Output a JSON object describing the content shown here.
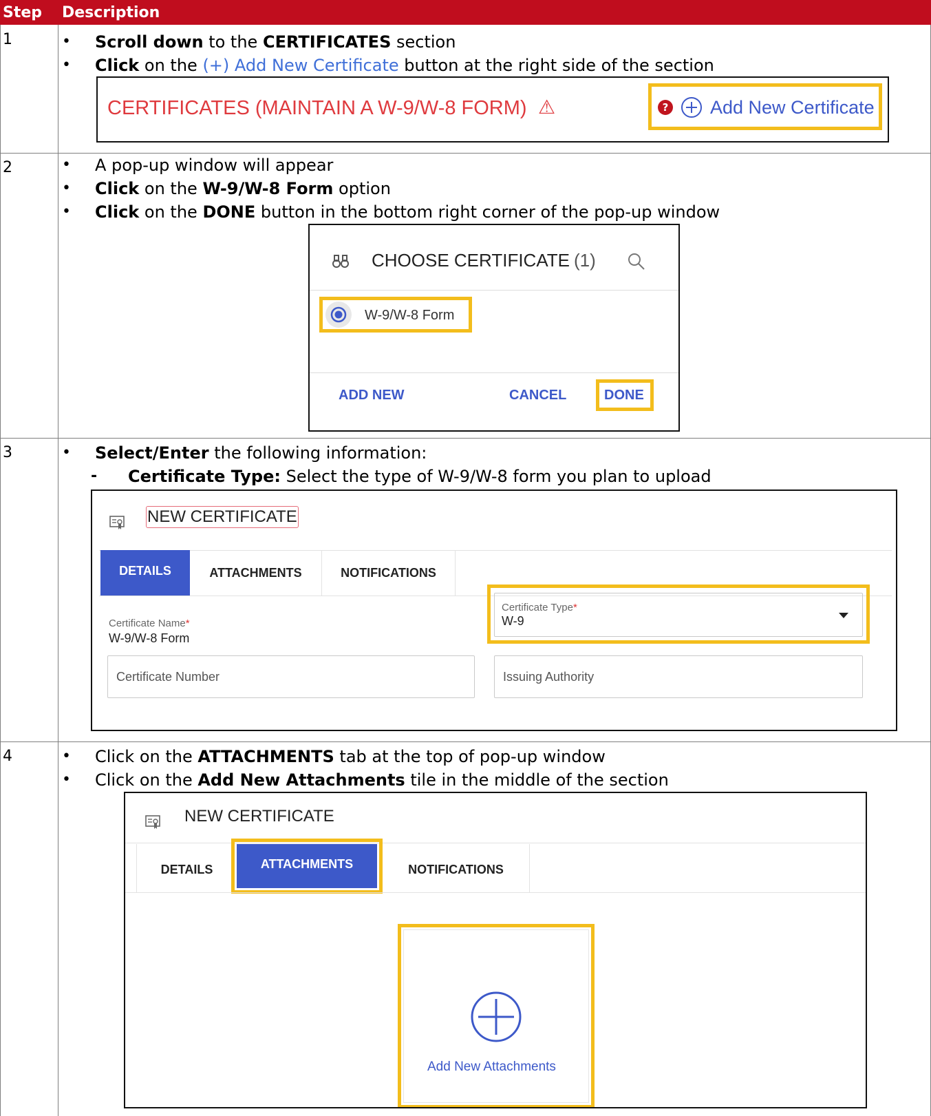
{
  "header": {
    "step": "Step",
    "description": "Description"
  },
  "steps": [
    {
      "number": "1",
      "bullets": [
        {
          "parts": [
            {
              "t": "Scroll down",
              "b": true
            },
            {
              "t": " to the "
            },
            {
              "t": "CERTIFICATES",
              "b": true
            },
            {
              "t": " section"
            }
          ]
        },
        {
          "parts": [
            {
              "t": "Click",
              "b": true
            },
            {
              "t": " on the "
            },
            {
              "t": "(+) Add New Certificate",
              "c": "blue"
            },
            {
              "t": " button at the right side of the section"
            }
          ]
        }
      ],
      "screenshot": {
        "section_title": "CERTIFICATES (MAINTAIN A W-9/W-8 FORM)",
        "warning_icon": "⚠",
        "help_icon": "?",
        "add_button": "Add New Certificate"
      }
    },
    {
      "number": "2",
      "bullets": [
        {
          "parts": [
            {
              "t": "A pop-up window will appear"
            }
          ]
        },
        {
          "parts": [
            {
              "t": "Click",
              "b": true
            },
            {
              "t": " on the "
            },
            {
              "t": "W-9/W-8 Form",
              "b": true
            },
            {
              "t": " option"
            }
          ]
        },
        {
          "parts": [
            {
              "t": "Click",
              "b": true
            },
            {
              "t": " on the "
            },
            {
              "t": "DONE",
              "b": true
            },
            {
              "t": " button in the bottom right corner of the pop-up window"
            }
          ]
        }
      ],
      "screenshot": {
        "title": "CHOOSE CERTIFICATE",
        "count": "(1)",
        "option": "W-9/W-8 Form",
        "add_new": "ADD NEW",
        "cancel": "CANCEL",
        "done": "DONE"
      }
    },
    {
      "number": "3",
      "bullets": [
        {
          "parts": [
            {
              "t": "Select/Enter",
              "b": true
            },
            {
              "t": " the following information:"
            }
          ]
        }
      ],
      "sub_bullets": [
        {
          "parts": [
            {
              "t": "Certificate Type:",
              "b": true
            },
            {
              "t": " Select the type of W-9/W-8 form you plan to upload"
            }
          ]
        }
      ],
      "screenshot": {
        "title": "NEW CERTIFICATE",
        "tabs": [
          "DETAILS",
          "ATTACHMENTS",
          "NOTIFICATIONS"
        ],
        "active_tab": "DETAILS",
        "cert_name_label": "Certificate Name",
        "cert_name_value": "W-9/W-8 Form",
        "cert_type_label": "Certificate Type",
        "cert_type_value": "W-9",
        "required_mark": "*",
        "cert_number_placeholder": "Certificate Number",
        "issuing_authority_placeholder": "Issuing Authority"
      }
    },
    {
      "number": "4",
      "bullets": [
        {
          "parts": [
            {
              "t": "Click on the "
            },
            {
              "t": "ATTACHMENTS",
              "b": true
            },
            {
              "t": " tab at the top of pop-up window"
            }
          ]
        },
        {
          "parts": [
            {
              "t": "Click on the "
            },
            {
              "t": "Add New Attachments",
              "b": true
            },
            {
              "t": " tile in the middle of the section"
            }
          ]
        }
      ],
      "screenshot": {
        "title": "NEW CERTIFICATE",
        "tabs": [
          "DETAILS",
          "ATTACHMENTS",
          "NOTIFICATIONS"
        ],
        "active_tab": "ATTACHMENTS",
        "tile_label": "Add New Attachments"
      }
    }
  ],
  "colors": {
    "header_red": "#c00d1e",
    "highlight": "#f3bd1c",
    "link_blue": "#3f6fd8",
    "tab_blue": "#3d59c9",
    "ui_blue": "#3d59c9",
    "cert_red": "#df3a3e"
  },
  "icons": {
    "bullet": "•",
    "dash": "-"
  }
}
